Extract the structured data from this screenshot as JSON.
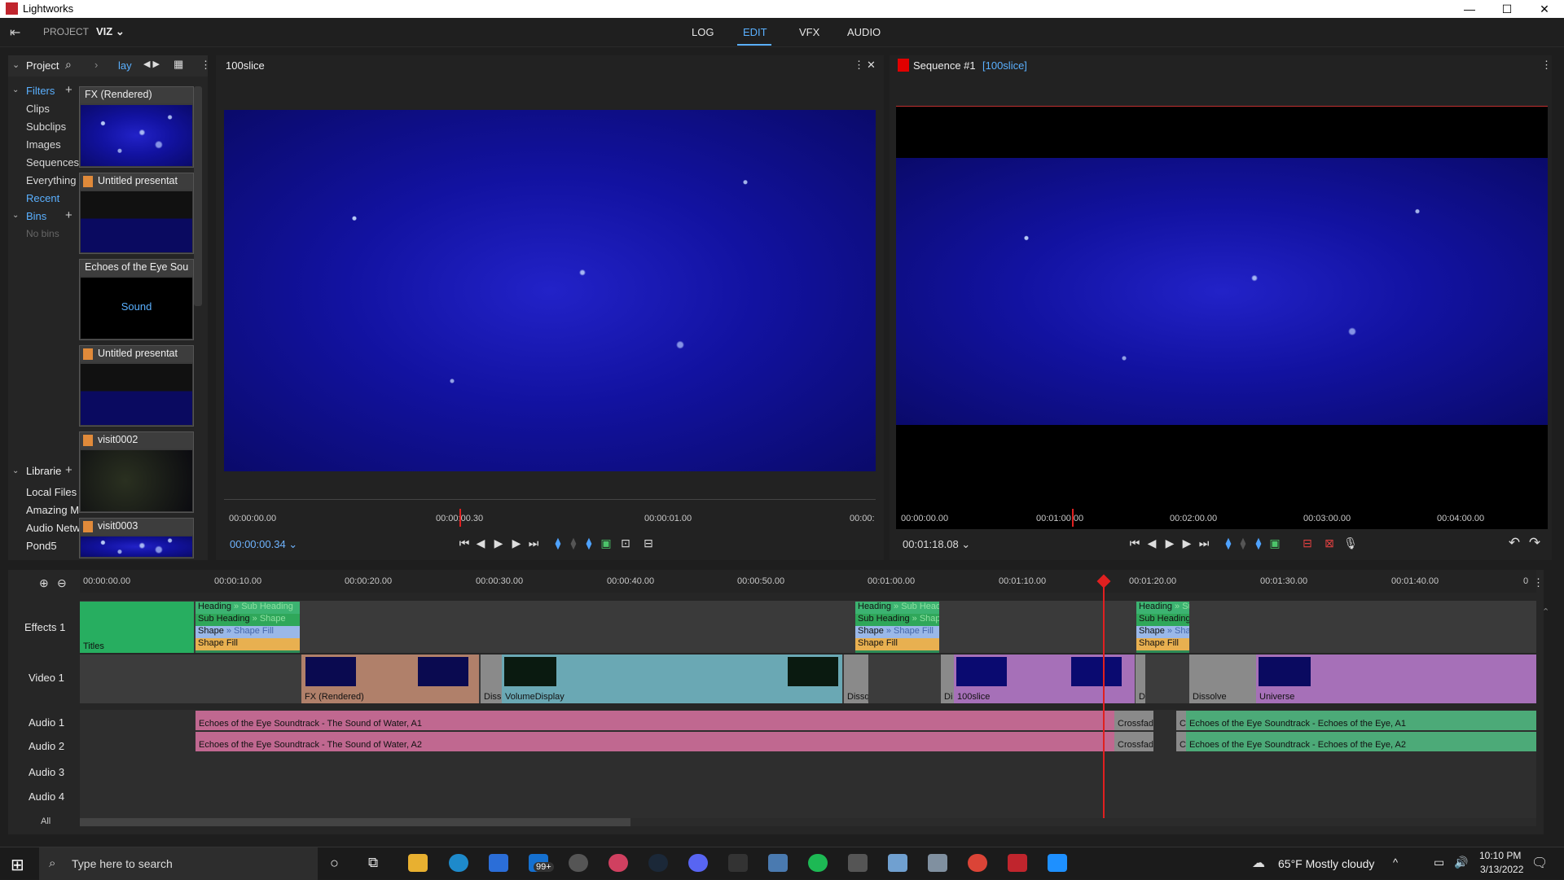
{
  "window": {
    "title": "Lightworks",
    "min": "—",
    "max": "☐",
    "close": "✕"
  },
  "top": {
    "project_label": "PROJECT",
    "project_name": "VIZ ⌄",
    "tabs": [
      "LOG",
      "EDIT",
      "VFX",
      "AUDIO"
    ],
    "active_tab": "EDIT"
  },
  "left": {
    "panel_title": "Project",
    "panel_view": "lay",
    "filters_label": "Filters",
    "filters": [
      "Clips",
      "Subclips",
      "Images",
      "Sequences",
      "Everything",
      "Recent"
    ],
    "bins_label": "Bins",
    "bins_empty": "No bins",
    "libraries_label": "Librarie",
    "libraries": [
      "Local Files",
      "Amazing M",
      "Audio Netw",
      "Pond5"
    ],
    "items": [
      {
        "title": "FX (Rendered)"
      },
      {
        "title": "Untitled presentat"
      },
      {
        "title": "Echoes of the Eye Sou",
        "note": "Sound"
      },
      {
        "title": "Untitled presentat"
      },
      {
        "title": "visit0002"
      },
      {
        "title": "visit0003"
      }
    ]
  },
  "source_viewer": {
    "title": "100slice",
    "ruler": [
      "00:00:00.00",
      "00:00:00.30",
      "00:00:01.00",
      "00:00:"
    ],
    "timecode": "00:00:00.34 ⌄"
  },
  "record_viewer": {
    "title": "Sequence #1",
    "subtitle": "[100slice]",
    "ruler": [
      "00:00:00.00",
      "00:01:00.00",
      "00:02:00.00",
      "00:03:00.00",
      "00:04:00.00"
    ],
    "timecode": "00:01:18.08 ⌄"
  },
  "timeline": {
    "ruler": [
      "00:00:00.00",
      "00:00:10.00",
      "00:00:20.00",
      "00:00:30.00",
      "00:00:40.00",
      "00:00:50.00",
      "00:01:00.00",
      "00:01:10.00",
      "00:01:20.00",
      "00:01:30.00",
      "00:01:40.00",
      "0"
    ],
    "tracks": [
      "Effects 1",
      "Video 1",
      "Audio 1",
      "Audio 2",
      "Audio 3",
      "Audio 4"
    ],
    "all_label": "All",
    "effects": {
      "titles": "Titles",
      "heading": "Heading",
      "sub_heading": "Sub Heading",
      "shape": "Shape",
      "shape_fill": "Shape Fill",
      "faint_sub": "» Sub Heading",
      "faint_shape": "» Shape",
      "faint_shapefill": "» Shape Fill"
    },
    "video": {
      "fx": "FX (Rendered)",
      "diss": "Diss",
      "vd": "VolumeDisplay",
      "dissq": "Dissq",
      "di": "Di",
      "slice": "100slice",
      "dissolve": "Dissolve",
      "universe": "Universe",
      "d": "D"
    },
    "audio": {
      "a1": "Echoes of the Eye Soundtrack - The Sound of Water, A1",
      "a2": "Echoes of the Eye Soundtrack - The Sound of Water, A2",
      "cross": "Crossfad",
      "cr": "Cr",
      "b1": "Echoes of the Eye Soundtrack - Echoes of the Eye, A1",
      "b2": "Echoes of the Eye Soundtrack - Echoes of the Eye, A2"
    }
  },
  "taskbar": {
    "search_placeholder": "Type here to search",
    "weather": "65°F  Mostly cloudy",
    "time": "10:10 PM",
    "date": "3/13/2022",
    "badge": "99+"
  }
}
